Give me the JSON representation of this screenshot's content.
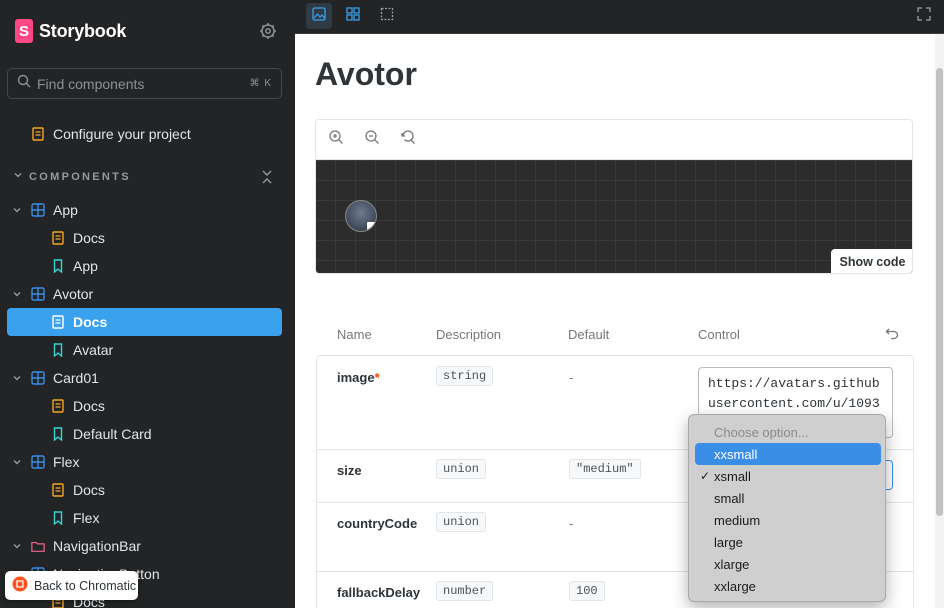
{
  "sidebar": {
    "brand": {
      "logo_letter": "S",
      "name": "Storybook"
    },
    "search": {
      "placeholder": "Find components",
      "shortcut": "⌘ K"
    },
    "configure": "Configure your project",
    "section_title": "COMPONENTS",
    "tree": [
      {
        "label": "App",
        "kind": "component"
      },
      {
        "label": "Docs",
        "kind": "docs"
      },
      {
        "label": "App",
        "kind": "story"
      },
      {
        "label": "Avotor",
        "kind": "component"
      },
      {
        "label": "Docs",
        "kind": "docs",
        "active": true
      },
      {
        "label": "Avatar",
        "kind": "story"
      },
      {
        "label": "Card01",
        "kind": "component"
      },
      {
        "label": "Docs",
        "kind": "docs"
      },
      {
        "label": "Default Card",
        "kind": "story"
      },
      {
        "label": "Flex",
        "kind": "component"
      },
      {
        "label": "Docs",
        "kind": "docs"
      },
      {
        "label": "Flex",
        "kind": "story"
      },
      {
        "label": "NavigationBar",
        "kind": "group"
      },
      {
        "label": "NavigationButton",
        "kind": "component"
      },
      {
        "label": "Docs",
        "kind": "docs"
      }
    ],
    "back_chromatic": "Back to Chromatic"
  },
  "main": {
    "title": "Avotor",
    "show_code": "Show code",
    "args_headers": {
      "name": "Name",
      "description": "Description",
      "default": "Default",
      "control": "Control"
    },
    "args": [
      {
        "name": "image",
        "required": "*",
        "type": "string",
        "default": "-"
      },
      {
        "name": "size",
        "type": "union",
        "default": "\"medium\""
      },
      {
        "name": "countryCode",
        "type": "union",
        "default": "-"
      },
      {
        "name": "fallbackDelay",
        "type": "number",
        "default": "100"
      }
    ],
    "image_control_value": "https://avatars.githubusercontent.com/u/1093"
  },
  "dropdown": {
    "placeholder": "Choose option...",
    "options": [
      "xxsmall",
      "xsmall",
      "small",
      "medium",
      "large",
      "xlarge",
      "xxlarge"
    ],
    "highlighted": "xxsmall",
    "checked": "xsmall",
    "check_mark": "✓"
  },
  "colors": {
    "accent": "#3aa1ee",
    "brand": "#ff4785",
    "docs_icon": "#f5a623",
    "story_icon": "#37d5d3",
    "component_icon": "#3a8ee6",
    "group_icon": "#f06292"
  }
}
